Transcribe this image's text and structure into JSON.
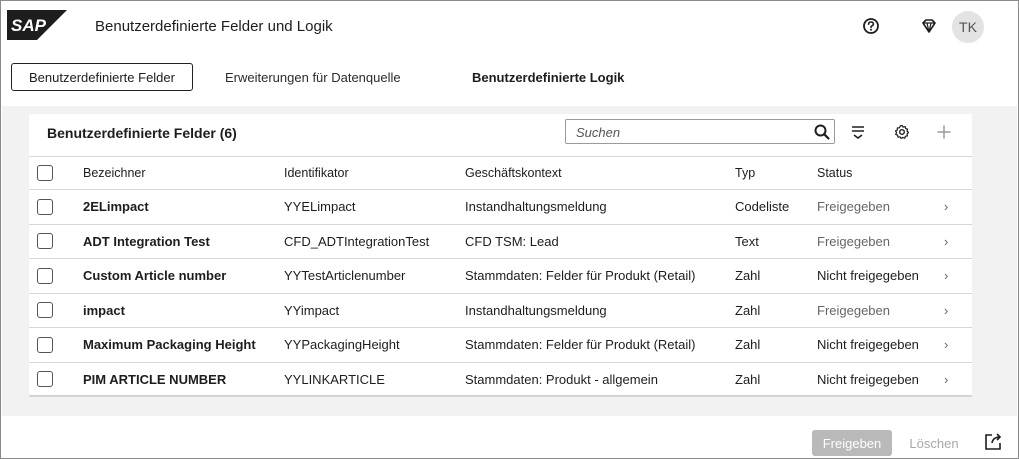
{
  "header": {
    "logo_text": "SAP",
    "title": "Benutzerdefinierte Felder und Logik",
    "avatar_initials": "TK",
    "icons": [
      "help-icon",
      "diamond-icon"
    ]
  },
  "tabs": [
    {
      "label": "Benutzerdefinierte Felder",
      "selected": true
    },
    {
      "label": "Erweiterungen für Datenquelle",
      "selected": false
    },
    {
      "label": "Benutzerdefinierte Logik",
      "selected": false
    }
  ],
  "panel": {
    "title": "Benutzerdefinierte Felder (6)",
    "search_placeholder": "Suchen",
    "toolbar_icons": [
      "search-icon",
      "sort-icon",
      "settings-icon",
      "add-icon"
    ]
  },
  "table": {
    "columns": {
      "name": "Bezeichner",
      "id": "Identifikator",
      "context": "Geschäftskontext",
      "type": "Typ",
      "status": "Status"
    },
    "rows": [
      {
        "name": "2ELimpact",
        "id": "YYELimpact",
        "context": "Instandhaltungsmeldung",
        "type": "Codeliste",
        "status": "Freigegeben"
      },
      {
        "name": "ADT Integration Test",
        "id": "CFD_ADTIntegrationTest",
        "context": "CFD TSM: Lead",
        "type": "Text",
        "status": "Freigegeben"
      },
      {
        "name": "Custom Article number",
        "id": "YYTestArticlenumber",
        "context": "Stammdaten: Felder für Produkt (Retail)",
        "type": "Zahl",
        "status": "Nicht freigegeben"
      },
      {
        "name": "impact",
        "id": "YYimpact",
        "context": "Instandhaltungsmeldung",
        "type": "Zahl",
        "status": "Freigegeben"
      },
      {
        "name": "Maximum Packaging Height",
        "id": "YYPackagingHeight",
        "context": "Stammdaten: Felder für Produkt (Retail)",
        "type": "Zahl",
        "status": "Nicht freigegeben"
      },
      {
        "name": "PIM ARTICLE NUMBER",
        "id": "YYLINKARTICLE",
        "context": "Stammdaten: Produkt - allgemein",
        "type": "Zahl",
        "status": "Nicht freigegeben"
      }
    ],
    "nav_glyph": "›"
  },
  "footer": {
    "release_label": "Freigeben",
    "delete_label": "Löschen"
  },
  "colors": {
    "accent": "#1d1d1d",
    "released_status": "#666666",
    "disabled_button": "#b9b9b9"
  }
}
